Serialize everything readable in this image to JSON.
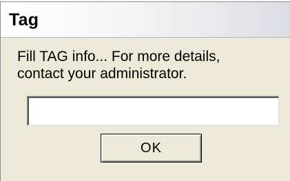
{
  "window": {
    "title": "Tag"
  },
  "dialog": {
    "message": "Fill TAG info... For more details,\ncontact your administrator.",
    "input_value": "",
    "input_placeholder": "",
    "ok_label": "OK"
  },
  "colors": {
    "window_background": "#ece9d8",
    "input_background": "#ffffff",
    "text": "#000000"
  }
}
